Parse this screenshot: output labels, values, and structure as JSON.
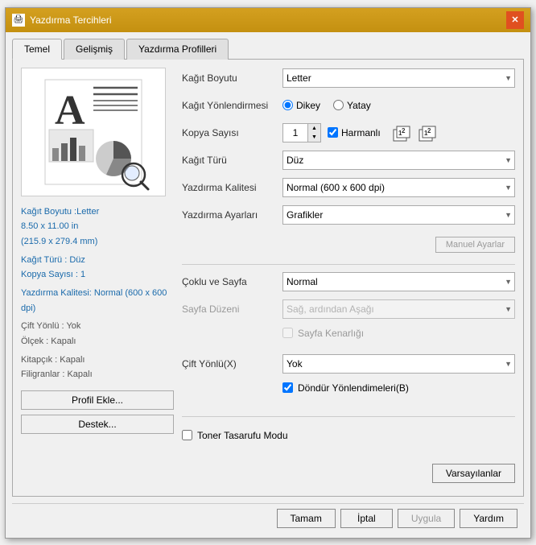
{
  "window": {
    "title": "Yazdırma Tercihleri",
    "title_prefix": "............",
    "close_btn": "✕"
  },
  "tabs": [
    {
      "id": "temel",
      "label": "Temel",
      "active": true
    },
    {
      "id": "gelismis",
      "label": "Gelişmiş",
      "active": false
    },
    {
      "id": "profiller",
      "label": "Yazdırma Profilleri",
      "active": false
    }
  ],
  "form": {
    "kagit_boyutu_label": "Kağıt Boyutu",
    "kagit_boyutu_value": "Letter",
    "kagit_yonlendirmesi_label": "Kağıt Yönlendirmesi",
    "dikey_label": "Dikey",
    "yatay_label": "Yatay",
    "kopya_sayisi_label": "Kopya Sayısı",
    "kopya_sayisi_value": "1",
    "harmanli_label": "Harmanlı",
    "kagit_turu_label": "Kağıt Türü",
    "kagit_turu_value": "Düz",
    "yazdir_kalitesi_label": "Yazdırma Kalitesi",
    "yazdir_kalitesi_value": "Normal (600 x 600 dpi)",
    "yazdir_ayarlari_label": "Yazdırma Ayarları",
    "yazdir_ayarlari_value": "Grafikler",
    "manuel_ayarlar_label": "Manuel Ayarlar",
    "coklu_sayfa_label": "Çoklu ve Sayfa",
    "coklu_sayfa_value": "Normal",
    "sayfa_duzeni_label": "Sayfa Düzeni",
    "sayfa_duzeni_value": "Sağ, ardından Aşağı",
    "sayfa_kenarligi_label": "Sayfa Kenarlığı",
    "cift_yonlu_label": "Çift Yönlü(X)",
    "cift_yonlu_value": "Yok",
    "dondur_yonlendirme_label": "Döndür Yönlendimeleri(B)",
    "toner_tasarufu_label": "Toner Tasarufu Modu"
  },
  "preview_info": {
    "boyut_label": "Kağıt Boyutu :Letter",
    "olcek_label": "8.50 x 11.00 in",
    "olcek_mm": "(215.9 x 279.4 mm)",
    "tur_label": "Kağıt Türü : Düz",
    "kopya_label": "Kopya Sayısı : 1",
    "kalite_label": "Yazdırma Kalitesi: Normal (600 x 600",
    "kalite_label2": "dpi)",
    "cift_label": "Çift Yönlü : Yok",
    "olcek2_label": "Ölçek : Kapalı",
    "kitapcik_label": "Kitapçık : Kapalı",
    "filigran_label": "Filigranlar : Kapalı"
  },
  "bottom_buttons": {
    "profil_ekle": "Profil Ekle...",
    "destek": "Destek...",
    "varsayilanlar": "Varsayılanlar"
  },
  "dialog_buttons": {
    "tamam": "Tamam",
    "iptal": "İptal",
    "uygula": "Uygula",
    "yardim": "Yardım"
  }
}
